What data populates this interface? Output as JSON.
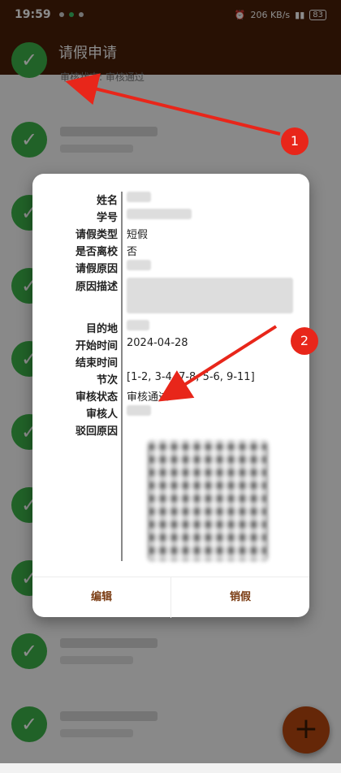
{
  "status_bar": {
    "time": "19:59",
    "network_speed": "206 KB/s",
    "battery": "83"
  },
  "app_bar": {
    "title": "请假申请"
  },
  "list": {
    "first_status": "审核状态: 审核通过"
  },
  "dialog": {
    "fields": [
      {
        "label": "姓名",
        "value": ""
      },
      {
        "label": "学号",
        "value": ""
      },
      {
        "label": "请假类型",
        "value": "短假"
      },
      {
        "label": "是否离校",
        "value": "否"
      },
      {
        "label": "请假原因",
        "value": ""
      },
      {
        "label": "原因描述",
        "value": ""
      },
      {
        "label": "目的地",
        "value": ""
      },
      {
        "label": "开始时间",
        "value": "2024-04-28"
      },
      {
        "label": "结束时间",
        "value": ""
      },
      {
        "label": "节次",
        "value": "[1-2, 3-4, 7-8, 5-6, 9-11]"
      },
      {
        "label": "审核状态",
        "value": "审核通过"
      },
      {
        "label": "审核人",
        "value": ""
      },
      {
        "label": "驳回原因",
        "value": ""
      }
    ],
    "edit_button": "编辑",
    "cancel_leave_button": "销假"
  },
  "annotations": [
    {
      "label": "1"
    },
    {
      "label": "2"
    }
  ],
  "colors": {
    "app_bar": "#4a1f08",
    "accent": "#7a3b12",
    "check": "#3db24a",
    "fab": "#b9470f",
    "marker": "#e8261a"
  }
}
